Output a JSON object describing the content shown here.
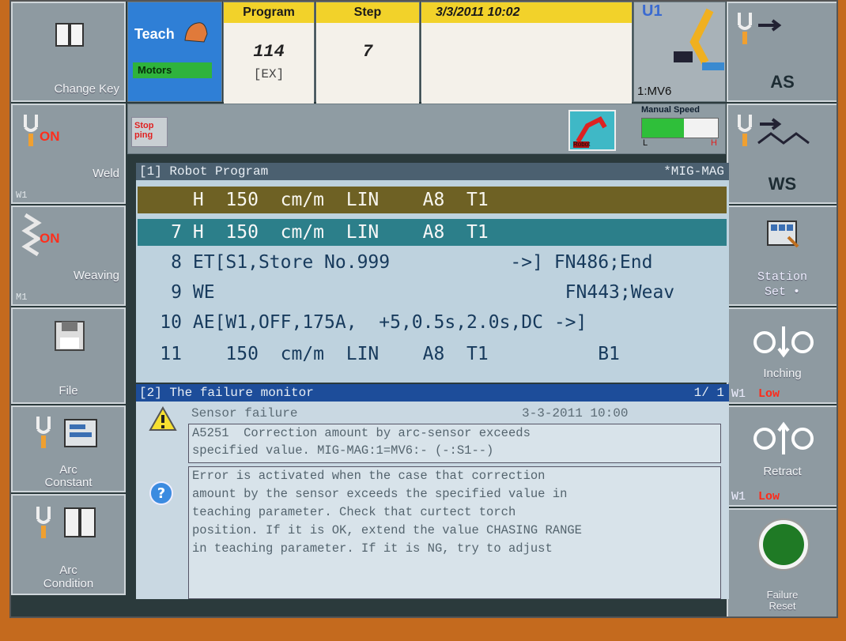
{
  "left_buttons": [
    {
      "label": "Change Key",
      "icon": "book-icon"
    },
    {
      "label": "Weld",
      "on": "ON",
      "sub": "W1",
      "icon": "torch-icon"
    },
    {
      "label": "Weaving",
      "on": "ON",
      "sub": "M1",
      "icon": "weave-icon"
    },
    {
      "label": "File",
      "icon": "floppy-icon"
    },
    {
      "label": "Arc\nConstant",
      "icon": "arc-constant-icon"
    },
    {
      "label": "Arc\nCondition",
      "icon": "arc-condition-icon"
    }
  ],
  "right_buttons": [
    {
      "label": "AS",
      "icon": "torch-arrow-icon"
    },
    {
      "label": "WS",
      "icon": "torch-wave-icon"
    },
    {
      "label": "Station\nSet •",
      "icon": "station-icon"
    },
    {
      "label": "Inching",
      "sub": "W1",
      "status": "Low",
      "icon": "inching-icon"
    },
    {
      "label": "Retract",
      "sub": "W1",
      "status": "Low",
      "icon": "retract-icon"
    },
    {
      "label": "Failure\nReset",
      "icon": "green-button-icon"
    }
  ],
  "status": {
    "mode": "Teach",
    "motors": "Motors",
    "program_header": "Program",
    "program_value": "114",
    "program_sub": "[EX]",
    "step_header": "Step",
    "step_value": "7",
    "datetime": "3/3/2011  10:02",
    "mechanism_top": "U1",
    "mechanism": "1:MV6",
    "stopping": "Stop\nping",
    "robot_icon_label": "Robot",
    "manual_speed_label": "Manual Speed",
    "manual_speed_fraction": 0.55,
    "manual_speed_low": "L",
    "manual_speed_high": "H"
  },
  "program_window": {
    "title": "[1] Robot Program",
    "process": "*MIG-MAG",
    "lines": [
      {
        "no": "",
        "text": "H  150  cm/m  LIN    A8  T1"
      },
      {
        "no": "7",
        "text": "H  150  cm/m  LIN    A8  T1"
      },
      {
        "no": "8",
        "text": "ET[S1,Store No.999           ->] FN486;End"
      },
      {
        "no": "9",
        "text": "WE                                FN443;Weav"
      },
      {
        "no": "10",
        "text": "AE[W1,OFF,175A,  +5,0.5s,2.0s,DC ->]"
      },
      {
        "no": "11",
        "text": "   150  cm/m  LIN    A8  T1          B1"
      }
    ]
  },
  "failure_window": {
    "title": "[2] The failure monitor",
    "page": "1/ 1",
    "type": "Sensor failure",
    "timestamp": "3-3-2011 10:00",
    "message_line1": "A5251  Correction amount by arc-sensor exceeds",
    "message_line2": "specified value. MIG-MAG:1=MV6:- (-:S1--)",
    "help_lines": [
      "Error is activated when the case that correction",
      "amount by the sensor exceeds the specified value in",
      "teaching parameter. Check that curtect torch",
      "position. If it is OK, extend the value CHASING RANGE",
      "in teaching parameter. If it is NG, try to adjust"
    ]
  },
  "colors": {
    "accent_yellow": "#f2d22a",
    "teach_blue": "#2f7fd6",
    "row_olive": "#6e6124",
    "row_teal": "#2c7f8a",
    "failure_bar": "#1d4d9a",
    "on_red": "#ff2e1c"
  }
}
